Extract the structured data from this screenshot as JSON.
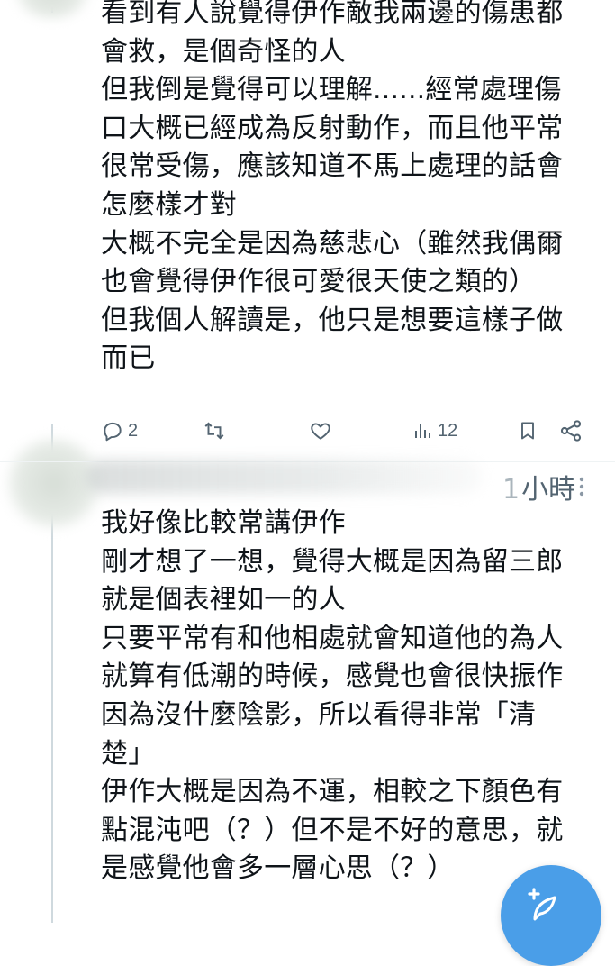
{
  "tweets": [
    {
      "lines": [
        "看到有人說覺得伊作敵我兩邊的傷患都",
        "會救，是個奇怪的人",
        "但我倒是覺得可以理解......經常處理傷",
        "口大概已經成為反射動作，而且他平常",
        "很常受傷，應該知道不馬上處理的話會",
        "怎麼樣才對",
        "大概不完全是因為慈悲心（雖然我偶爾",
        "也會覺得伊作很可愛很天使之類的）",
        "但我個人解讀是，他只是想要這樣子做",
        "而已"
      ],
      "actions": {
        "reply_count": "2",
        "retweet_count": "",
        "like_count": "",
        "view_count": "12"
      }
    },
    {
      "time_number": "1",
      "time_unit": "小時",
      "lines": [
        "我好像比較常講伊作",
        "剛才想了一想，覺得大概是因為留三郎",
        "就是個表裡如一的人",
        "只要平常有和他相處就會知道他的為人",
        "就算有低潮的時候，感覺也會很快振作",
        "因為沒什麼陰影，所以看得非常「清",
        "楚」",
        "伊作大概是因為不運，相較之下顏色有",
        "點混沌吧（？）但不是不好的意思，就",
        "是感覺他會多一層心思（？）"
      ]
    }
  ],
  "icons": {
    "reply": "reply-icon",
    "retweet": "retweet-icon",
    "like": "heart-icon",
    "views": "views-icon",
    "bookmark": "bookmark-icon",
    "share": "share-icon",
    "more": "more-vertical-icon",
    "compose": "compose-icon"
  },
  "colors": {
    "text": "#0f1419",
    "secondary": "#536471",
    "thread_line": "#cfd9de",
    "accent": "#4a9ee8"
  }
}
